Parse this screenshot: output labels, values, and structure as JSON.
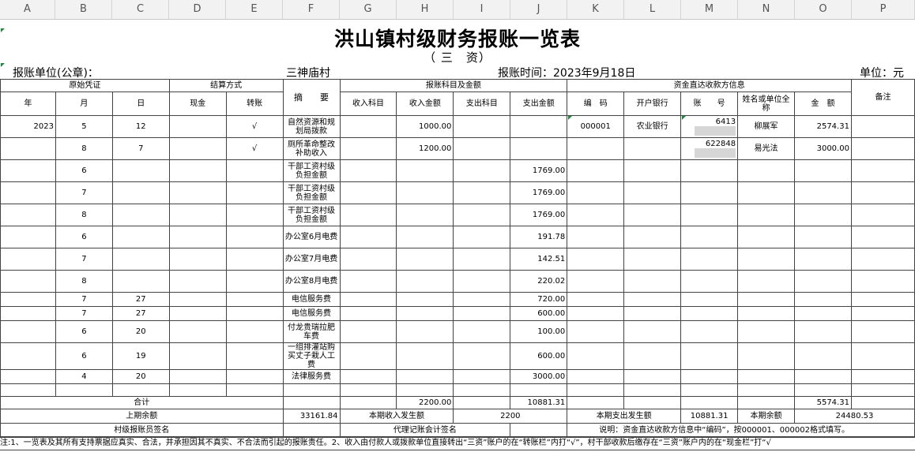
{
  "columns": [
    "A",
    "B",
    "C",
    "D",
    "E",
    "F",
    "G",
    "H",
    "I",
    "J",
    "K",
    "L",
    "M",
    "N",
    "O",
    "P"
  ],
  "title": "洪山镇村级财务报账一览表",
  "subtitle": "（ 三　资）",
  "header_info": {
    "unit_label": "报账单位(公章)：",
    "village": "三神庙村",
    "time_label": "报账时间：2023年9月18日",
    "currency_unit": "单位：元"
  },
  "table_headers": {
    "voucher_group": "原始凭证",
    "settlement_group": "结算方式",
    "memo": "摘　　要",
    "subject_group": "报账科目及金额",
    "payee_group": "资金直达收款方信息",
    "remarks": "备注",
    "year": "年",
    "month": "月",
    "day": "日",
    "cash": "现金",
    "transfer": "转账",
    "income_subject": "收入科目",
    "income_amount": "收入金额",
    "expense_subject": "支出科目",
    "expense_amount": "支出金额",
    "code": "编　码",
    "bank": "开户银行",
    "account": "账　　号",
    "name": "姓名或单位全称",
    "amount": "金　额"
  },
  "rows": [
    {
      "year": "2023",
      "month": "5",
      "day": "12",
      "cash": "",
      "transfer": "√",
      "memo": "自然资源和规划局拨款",
      "income_subject": "",
      "income_amount": "1000.00",
      "expense_subject": "",
      "expense_amount": "",
      "code": "000001",
      "bank": "农业银行",
      "account": "6413",
      "name": "柳展军",
      "amount": "2574.31",
      "remarks": ""
    },
    {
      "year": "",
      "month": "8",
      "day": "7",
      "cash": "",
      "transfer": "√",
      "memo": "厕所革命整改补助收入",
      "income_subject": "",
      "income_amount": "1200.00",
      "expense_subject": "",
      "expense_amount": "",
      "code": "",
      "bank": "",
      "account": "622848",
      "name": "易光法",
      "amount": "3000.00",
      "remarks": ""
    },
    {
      "year": "",
      "month": "6",
      "day": "",
      "cash": "",
      "transfer": "",
      "memo": "干部工资村级负担金额",
      "income_subject": "",
      "income_amount": "",
      "expense_subject": "",
      "expense_amount": "1769.00",
      "code": "",
      "bank": "",
      "account": "",
      "name": "",
      "amount": "",
      "remarks": ""
    },
    {
      "year": "",
      "month": "7",
      "day": "",
      "cash": "",
      "transfer": "",
      "memo": "干部工资村级负担金额",
      "income_subject": "",
      "income_amount": "",
      "expense_subject": "",
      "expense_amount": "1769.00",
      "code": "",
      "bank": "",
      "account": "",
      "name": "",
      "amount": "",
      "remarks": ""
    },
    {
      "year": "",
      "month": "8",
      "day": "",
      "cash": "",
      "transfer": "",
      "memo": "干部工资村级负担金额",
      "income_subject": "",
      "income_amount": "",
      "expense_subject": "",
      "expense_amount": "1769.00",
      "code": "",
      "bank": "",
      "account": "",
      "name": "",
      "amount": "",
      "remarks": ""
    },
    {
      "year": "",
      "month": "6",
      "day": "",
      "cash": "",
      "transfer": "",
      "memo": "办公室6月电费",
      "income_subject": "",
      "income_amount": "",
      "expense_subject": "",
      "expense_amount": "191.78",
      "code": "",
      "bank": "",
      "account": "",
      "name": "",
      "amount": "",
      "remarks": ""
    },
    {
      "year": "",
      "month": "7",
      "day": "",
      "cash": "",
      "transfer": "",
      "memo": "办公室7月电费",
      "income_subject": "",
      "income_amount": "",
      "expense_subject": "",
      "expense_amount": "142.51",
      "code": "",
      "bank": "",
      "account": "",
      "name": "",
      "amount": "",
      "remarks": ""
    },
    {
      "year": "",
      "month": "8",
      "day": "",
      "cash": "",
      "transfer": "",
      "memo": "办公室8月电费",
      "income_subject": "",
      "income_amount": "",
      "expense_subject": "",
      "expense_amount": "220.02",
      "code": "",
      "bank": "",
      "account": "",
      "name": "",
      "amount": "",
      "remarks": ""
    },
    {
      "year": "",
      "month": "7",
      "day": "27",
      "cash": "",
      "transfer": "",
      "memo": "电信服务费",
      "income_subject": "",
      "income_amount": "",
      "expense_subject": "",
      "expense_amount": "720.00",
      "code": "",
      "bank": "",
      "account": "",
      "name": "",
      "amount": "",
      "remarks": ""
    },
    {
      "year": "",
      "month": "7",
      "day": "27",
      "cash": "",
      "transfer": "",
      "memo": "电信服务费",
      "income_subject": "",
      "income_amount": "",
      "expense_subject": "",
      "expense_amount": "600.00",
      "code": "",
      "bank": "",
      "account": "",
      "name": "",
      "amount": "",
      "remarks": ""
    },
    {
      "year": "",
      "month": "6",
      "day": "20",
      "cash": "",
      "transfer": "",
      "memo": "付龙贵瑞拉肥车费",
      "income_subject": "",
      "income_amount": "",
      "expense_subject": "",
      "expense_amount": "100.00",
      "code": "",
      "bank": "",
      "account": "",
      "name": "",
      "amount": "",
      "remarks": ""
    },
    {
      "year": "",
      "month": "6",
      "day": "19",
      "cash": "",
      "transfer": "",
      "memo": "一组排灌站购买丈子栽人工费",
      "income_subject": "",
      "income_amount": "",
      "expense_subject": "",
      "expense_amount": "600.00",
      "code": "",
      "bank": "",
      "account": "",
      "name": "",
      "amount": "",
      "remarks": ""
    },
    {
      "year": "",
      "month": "4",
      "day": "20",
      "cash": "",
      "transfer": "",
      "memo": "法律服务费",
      "income_subject": "",
      "income_amount": "",
      "expense_subject": "",
      "expense_amount": "3000.00",
      "code": "",
      "bank": "",
      "account": "",
      "name": "",
      "amount": "",
      "remarks": ""
    },
    {
      "year": "",
      "month": "",
      "day": "",
      "cash": "",
      "transfer": "",
      "memo": "",
      "income_subject": "",
      "income_amount": "",
      "expense_subject": "",
      "expense_amount": "",
      "code": "",
      "bank": "",
      "account": "",
      "name": "",
      "amount": "",
      "remarks": ""
    }
  ],
  "totals": {
    "label": "合计",
    "income_amount": "2200.00",
    "expense_amount": "10881.31",
    "amount": "5574.31"
  },
  "summary": {
    "prev_balance_label": "上期余额",
    "prev_balance": "33161.84",
    "period_income_label": "本期收入发生额",
    "period_income": "2200",
    "period_expense_label": "本期支出发生额",
    "period_expense": "10881.31",
    "current_balance_label": "本期余额",
    "current_balance": "24480.53"
  },
  "signatures": {
    "clerk": "村级报账员签名",
    "agent": "代理记账会计签名",
    "instruction": "说明：资金直达收款方信息中“编码”，按000001、000002格式填写。"
  },
  "note": "注:1、一览表及其所有支持票据应真实、合法，并承担因其不真实、不合法而引起的报账责任。2、收入由付款人或拨款单位直接转出“三资”账户的在“转账栏”内打“√”，村干部收款后缴存在“三资”账户内的在“现金栏”打“√"
}
